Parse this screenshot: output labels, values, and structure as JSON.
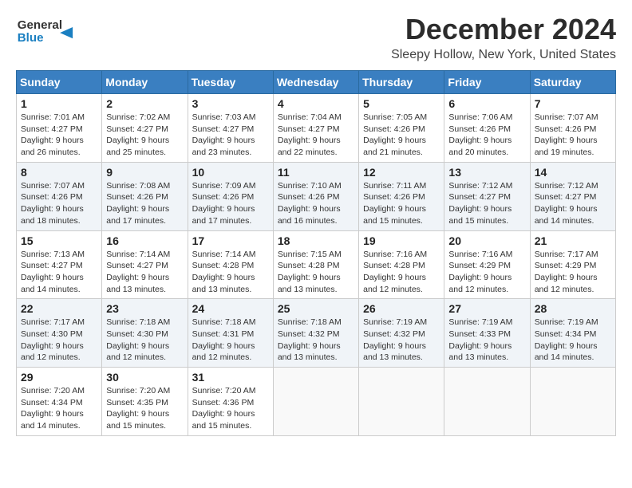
{
  "app": {
    "logo_general": "General",
    "logo_blue": "Blue"
  },
  "header": {
    "month": "December 2024",
    "location": "Sleepy Hollow, New York, United States"
  },
  "weekdays": [
    "Sunday",
    "Monday",
    "Tuesday",
    "Wednesday",
    "Thursday",
    "Friday",
    "Saturday"
  ],
  "weeks": [
    [
      {
        "day": 1,
        "sunrise": "7:01 AM",
        "sunset": "4:27 PM",
        "daylight": "9 hours and 26 minutes."
      },
      {
        "day": 2,
        "sunrise": "7:02 AM",
        "sunset": "4:27 PM",
        "daylight": "9 hours and 25 minutes."
      },
      {
        "day": 3,
        "sunrise": "7:03 AM",
        "sunset": "4:27 PM",
        "daylight": "9 hours and 23 minutes."
      },
      {
        "day": 4,
        "sunrise": "7:04 AM",
        "sunset": "4:27 PM",
        "daylight": "9 hours and 22 minutes."
      },
      {
        "day": 5,
        "sunrise": "7:05 AM",
        "sunset": "4:26 PM",
        "daylight": "9 hours and 21 minutes."
      },
      {
        "day": 6,
        "sunrise": "7:06 AM",
        "sunset": "4:26 PM",
        "daylight": "9 hours and 20 minutes."
      },
      {
        "day": 7,
        "sunrise": "7:07 AM",
        "sunset": "4:26 PM",
        "daylight": "9 hours and 19 minutes."
      }
    ],
    [
      {
        "day": 8,
        "sunrise": "7:07 AM",
        "sunset": "4:26 PM",
        "daylight": "9 hours and 18 minutes."
      },
      {
        "day": 9,
        "sunrise": "7:08 AM",
        "sunset": "4:26 PM",
        "daylight": "9 hours and 17 minutes."
      },
      {
        "day": 10,
        "sunrise": "7:09 AM",
        "sunset": "4:26 PM",
        "daylight": "9 hours and 17 minutes."
      },
      {
        "day": 11,
        "sunrise": "7:10 AM",
        "sunset": "4:26 PM",
        "daylight": "9 hours and 16 minutes."
      },
      {
        "day": 12,
        "sunrise": "7:11 AM",
        "sunset": "4:26 PM",
        "daylight": "9 hours and 15 minutes."
      },
      {
        "day": 13,
        "sunrise": "7:12 AM",
        "sunset": "4:27 PM",
        "daylight": "9 hours and 15 minutes."
      },
      {
        "day": 14,
        "sunrise": "7:12 AM",
        "sunset": "4:27 PM",
        "daylight": "9 hours and 14 minutes."
      }
    ],
    [
      {
        "day": 15,
        "sunrise": "7:13 AM",
        "sunset": "4:27 PM",
        "daylight": "9 hours and 14 minutes."
      },
      {
        "day": 16,
        "sunrise": "7:14 AM",
        "sunset": "4:27 PM",
        "daylight": "9 hours and 13 minutes."
      },
      {
        "day": 17,
        "sunrise": "7:14 AM",
        "sunset": "4:28 PM",
        "daylight": "9 hours and 13 minutes."
      },
      {
        "day": 18,
        "sunrise": "7:15 AM",
        "sunset": "4:28 PM",
        "daylight": "9 hours and 13 minutes."
      },
      {
        "day": 19,
        "sunrise": "7:16 AM",
        "sunset": "4:28 PM",
        "daylight": "9 hours and 12 minutes."
      },
      {
        "day": 20,
        "sunrise": "7:16 AM",
        "sunset": "4:29 PM",
        "daylight": "9 hours and 12 minutes."
      },
      {
        "day": 21,
        "sunrise": "7:17 AM",
        "sunset": "4:29 PM",
        "daylight": "9 hours and 12 minutes."
      }
    ],
    [
      {
        "day": 22,
        "sunrise": "7:17 AM",
        "sunset": "4:30 PM",
        "daylight": "9 hours and 12 minutes."
      },
      {
        "day": 23,
        "sunrise": "7:18 AM",
        "sunset": "4:30 PM",
        "daylight": "9 hours and 12 minutes."
      },
      {
        "day": 24,
        "sunrise": "7:18 AM",
        "sunset": "4:31 PM",
        "daylight": "9 hours and 12 minutes."
      },
      {
        "day": 25,
        "sunrise": "7:18 AM",
        "sunset": "4:32 PM",
        "daylight": "9 hours and 13 minutes."
      },
      {
        "day": 26,
        "sunrise": "7:19 AM",
        "sunset": "4:32 PM",
        "daylight": "9 hours and 13 minutes."
      },
      {
        "day": 27,
        "sunrise": "7:19 AM",
        "sunset": "4:33 PM",
        "daylight": "9 hours and 13 minutes."
      },
      {
        "day": 28,
        "sunrise": "7:19 AM",
        "sunset": "4:34 PM",
        "daylight": "9 hours and 14 minutes."
      }
    ],
    [
      {
        "day": 29,
        "sunrise": "7:20 AM",
        "sunset": "4:34 PM",
        "daylight": "9 hours and 14 minutes."
      },
      {
        "day": 30,
        "sunrise": "7:20 AM",
        "sunset": "4:35 PM",
        "daylight": "9 hours and 15 minutes."
      },
      {
        "day": 31,
        "sunrise": "7:20 AM",
        "sunset": "4:36 PM",
        "daylight": "9 hours and 15 minutes."
      },
      null,
      null,
      null,
      null
    ]
  ],
  "labels": {
    "sunrise": "Sunrise:",
    "sunset": "Sunset:",
    "daylight": "Daylight:"
  }
}
